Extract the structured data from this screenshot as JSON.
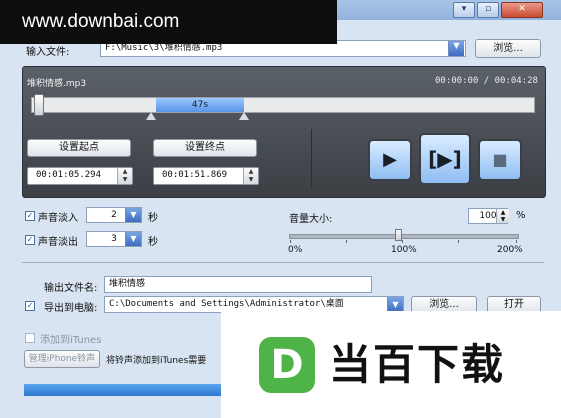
{
  "watermark": {
    "text": "www.downbai.com"
  },
  "window_controls": {
    "min": "▾",
    "max": "▫",
    "close": "✕"
  },
  "input_file": {
    "label": "输入文件:",
    "path": "F:\\Music\\3\\堆积情感.mp3",
    "browse_label": "浏览..."
  },
  "player": {
    "track_name": "堆积情感.mp3",
    "time_display": "00:00:00 / 00:04:28",
    "selection_length": "47s",
    "set_start_label": "设置起点",
    "set_end_label": "设置终点",
    "start_time": "00:01:05.294",
    "end_time": "00:01:51.869"
  },
  "audio": {
    "fade_in_label": "声音淡入",
    "fade_in_value": "2",
    "fade_out_label": "声音淡出",
    "fade_out_value": "3",
    "seconds_unit": "秒",
    "volume_label": "音量大小:",
    "volume_value": "100",
    "percent_unit": "%",
    "volume_ticks": [
      "0%",
      "100%",
      "200%"
    ]
  },
  "output": {
    "filename_label": "输出文件名:",
    "filename_value": "堆积情感",
    "export_pc_label": "导出到电脑:",
    "export_path": "C:\\Documents and Settings\\Administrator\\桌面",
    "browse_label": "浏览...",
    "open_label": "打开",
    "itunes_label": "添加到iTunes",
    "manage_label": "管理iPhone铃声",
    "itunes_note": "将铃声添加到iTunes需要"
  },
  "logo": {
    "letter": "D",
    "text": "当百下载"
  }
}
